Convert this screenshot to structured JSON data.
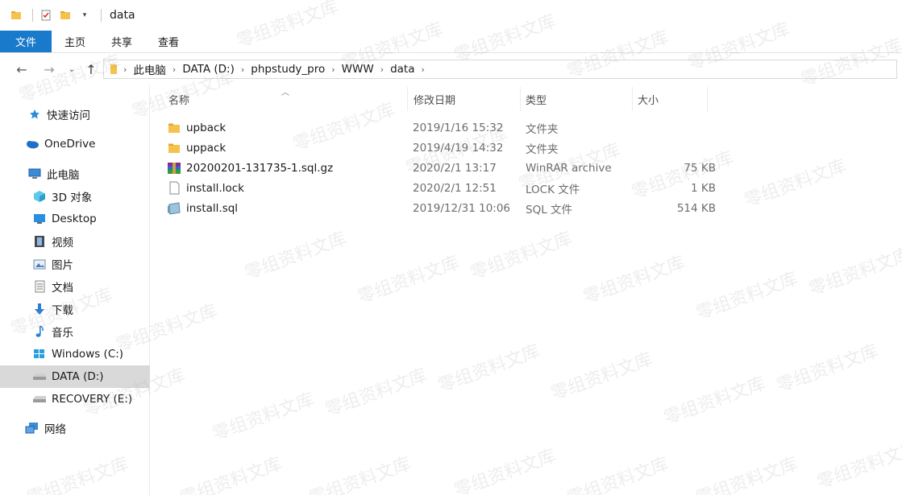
{
  "window": {
    "title": "data"
  },
  "ribbon": {
    "tabs": [
      "文件",
      "主页",
      "共享",
      "查看"
    ]
  },
  "breadcrumb": [
    "此电脑",
    "DATA (D:)",
    "phpstudy_pro",
    "WWW",
    "data"
  ],
  "sidebar": {
    "items": [
      {
        "label": "快速访问",
        "icon": "star-icon"
      },
      {
        "label": "OneDrive",
        "icon": "cloud-icon"
      },
      {
        "label": "此电脑",
        "icon": "computer-icon"
      },
      {
        "label": "3D 对象",
        "icon": "cube-icon"
      },
      {
        "label": "Desktop",
        "icon": "desktop-icon"
      },
      {
        "label": "视频",
        "icon": "video-icon"
      },
      {
        "label": "图片",
        "icon": "picture-icon"
      },
      {
        "label": "文档",
        "icon": "document-icon"
      },
      {
        "label": "下载",
        "icon": "download-icon"
      },
      {
        "label": "音乐",
        "icon": "music-icon"
      },
      {
        "label": "Windows (C:)",
        "icon": "windows-drive-icon"
      },
      {
        "label": "DATA (D:)",
        "icon": "drive-icon",
        "selected": true
      },
      {
        "label": "RECOVERY (E:)",
        "icon": "drive-icon"
      },
      {
        "label": "网络",
        "icon": "network-icon"
      }
    ]
  },
  "columns": {
    "name": "名称",
    "date": "修改日期",
    "type": "类型",
    "size": "大小"
  },
  "files": [
    {
      "name": "upback",
      "date": "2019/1/16 15:32",
      "type": "文件夹",
      "size": "",
      "icon": "folder-icon"
    },
    {
      "name": "uppack",
      "date": "2019/4/19 14:32",
      "type": "文件夹",
      "size": "",
      "icon": "folder-icon"
    },
    {
      "name": "20200201-131735-1.sql.gz",
      "date": "2020/2/1 13:17",
      "type": "WinRAR archive",
      "size": "75 KB",
      "icon": "winrar-icon"
    },
    {
      "name": "install.lock",
      "date": "2020/2/1 12:51",
      "type": "LOCK 文件",
      "size": "1 KB",
      "icon": "file-icon"
    },
    {
      "name": "install.sql",
      "date": "2019/12/31 10:06",
      "type": "SQL 文件",
      "size": "514 KB",
      "icon": "sql-file-icon"
    }
  ],
  "watermark": "零组资料文库",
  "colors": {
    "accent": "#1979ca",
    "selection": "#d9d9d9"
  }
}
